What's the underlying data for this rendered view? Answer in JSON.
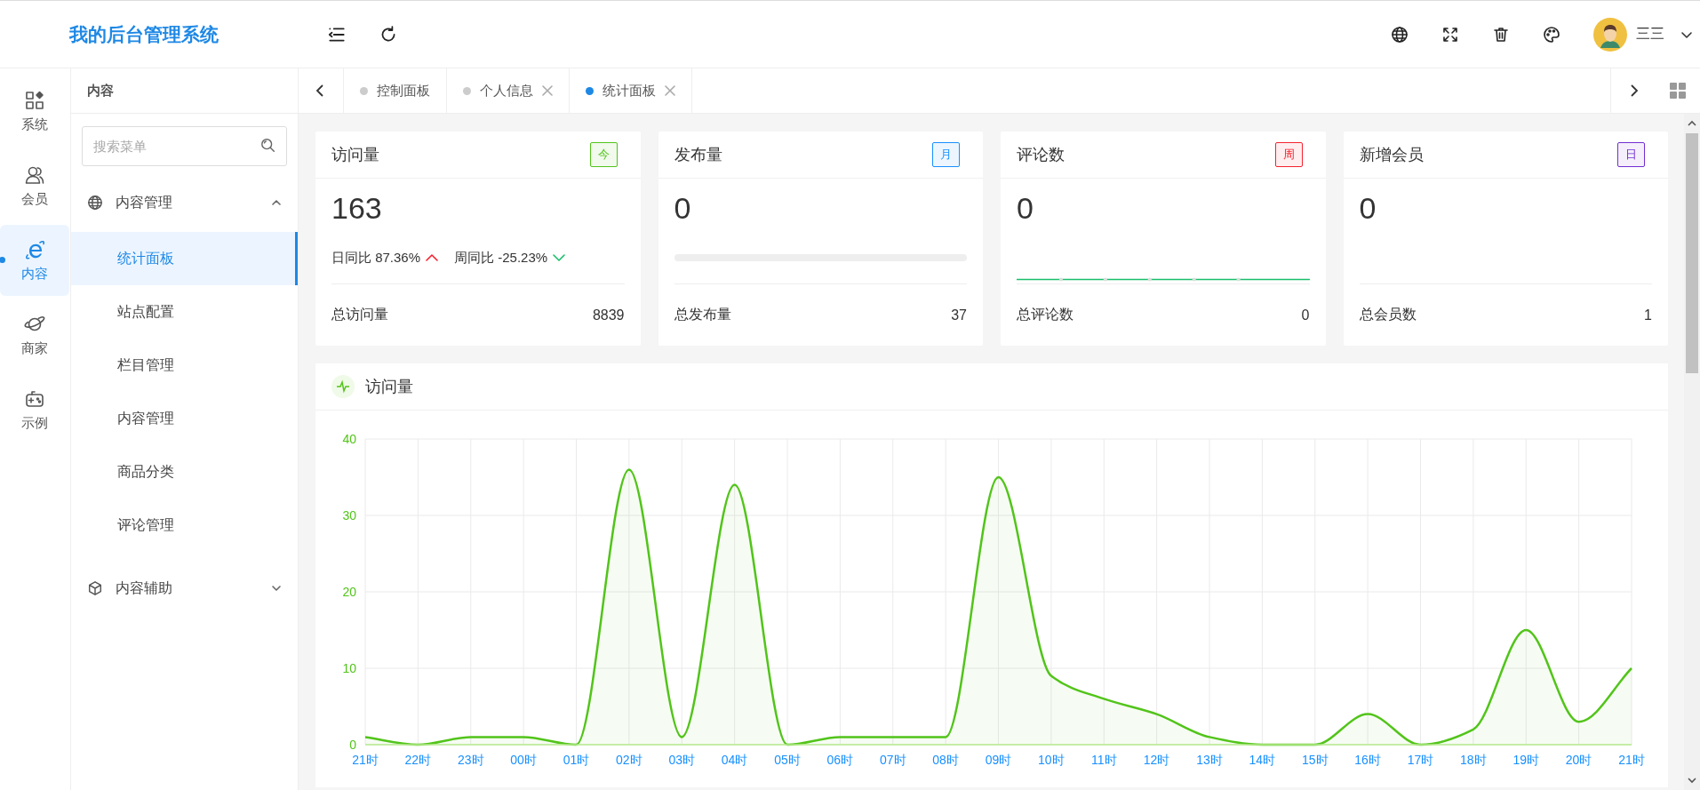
{
  "header": {
    "title": "我的后台管理系统",
    "user_name": "三三"
  },
  "rail": [
    {
      "label": "系统",
      "selected": false
    },
    {
      "label": "会员",
      "selected": false
    },
    {
      "label": "内容",
      "selected": true
    },
    {
      "label": "商家",
      "selected": false
    },
    {
      "label": "示例",
      "selected": false
    }
  ],
  "submenu": {
    "title": "内容",
    "search": {
      "placeholder": "搜索菜单"
    },
    "groups": [
      {
        "label": "内容管理",
        "expanded": true,
        "children": [
          {
            "label": "统计面板",
            "selected": true
          },
          {
            "label": "站点配置",
            "selected": false
          },
          {
            "label": "栏目管理",
            "selected": false
          },
          {
            "label": "内容管理",
            "selected": false
          },
          {
            "label": "商品分类",
            "selected": false
          },
          {
            "label": "评论管理",
            "selected": false
          }
        ]
      },
      {
        "label": "内容辅助",
        "expanded": false
      }
    ]
  },
  "tabs": [
    {
      "label": "控制面板",
      "selected": false,
      "closable": false
    },
    {
      "label": "个人信息",
      "selected": false,
      "closable": true
    },
    {
      "label": "统计面板",
      "selected": true,
      "closable": true
    }
  ],
  "stats": [
    {
      "kind": "trend",
      "title": "访问量",
      "badge": "今",
      "color": "#52c41a",
      "value": "163",
      "trends": [
        {
          "label": "日同比 87.36%",
          "kind": "up"
        },
        {
          "label": "周同比 -25.23%",
          "kind": "down"
        }
      ],
      "footer_label": "总访问量",
      "footer_value": "8839"
    },
    {
      "kind": "progress",
      "title": "发布量",
      "badge": "月",
      "color": "#1890ff",
      "value": "0",
      "level": 0,
      "footer_label": "总发布量",
      "footer_value": "37"
    },
    {
      "kind": "sparkline",
      "title": "评论数",
      "badge": "周",
      "color": "#f5222d",
      "value": "0",
      "footer_label": "总评论数",
      "footer_value": "0"
    },
    {
      "kind": "plain",
      "title": "新增会员",
      "badge": "日",
      "color": "#722ed1",
      "value": "0",
      "footer_label": "总会员数",
      "footer_value": "1"
    }
  ],
  "chart_card": {
    "title": "访问量",
    "chart_data": {
      "type": "area",
      "categories": [
        "21时",
        "22时",
        "23时",
        "00时",
        "01时",
        "02时",
        "03时",
        "04时",
        "05时",
        "06时",
        "07时",
        "08时",
        "09时",
        "10时",
        "11时",
        "12时",
        "13时",
        "14时",
        "15时",
        "16时",
        "17时",
        "18时",
        "19时",
        "20时",
        "21时"
      ],
      "grid": true,
      "series": [
        {
          "color": "#52c41a",
          "values": [
            1,
            0,
            1,
            1,
            0,
            36,
            1,
            34,
            0,
            1,
            1,
            1,
            35,
            9,
            6,
            4,
            1,
            0,
            0,
            4,
            0,
            2,
            15,
            3,
            10
          ]
        }
      ],
      "ylim": [
        0,
        40
      ],
      "yticks": [
        0,
        10,
        20,
        30,
        40
      ]
    }
  }
}
